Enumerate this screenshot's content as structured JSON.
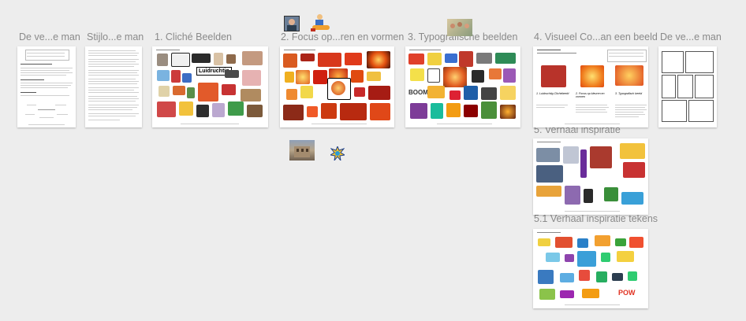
{
  "boards": [
    {
      "label": "De ve...e man"
    },
    {
      "label": "Stijlo...e man"
    },
    {
      "label": "1. Cliché Beelden"
    },
    {
      "label": "2. Focus op...ren en vormen"
    },
    {
      "label": "3. Typografische beelden"
    },
    {
      "label": "4. Visueel Co...an een beeld"
    },
    {
      "label": "De ve...e man"
    },
    {
      "label": "5. Verhaal inspiratie"
    },
    {
      "label": "5.1 Verhaal inspiratie tekens"
    }
  ],
  "page_texts": {
    "luidruchtig": "Luidruchtig",
    "onomatopee_1": "BOOM",
    "onomatopee_2": "POW",
    "step1": "1. Luidruchtig Clichébeeld",
    "step2": "2. Focus op kleuren en vormen",
    "step3": "3. Typografisch beeld"
  },
  "icons": [
    "portrait-photo-icon",
    "person-with-vacuum-icon",
    "group-photo-icon",
    "building-photo-icon",
    "comic-burst-icon"
  ]
}
